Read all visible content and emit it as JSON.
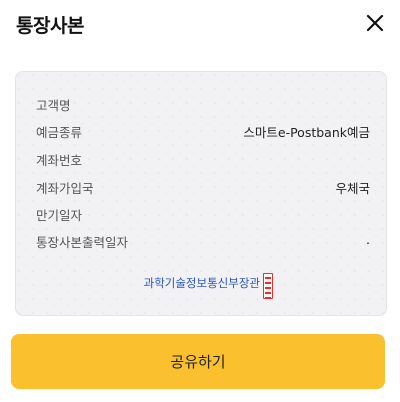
{
  "header": {
    "title": "통장사본",
    "close_icon": "close-icon"
  },
  "card": {
    "rows": [
      {
        "label": "고객명",
        "value": ""
      },
      {
        "label": "예금종류",
        "value": "스마트e-Postbank예금"
      },
      {
        "label": "계좌번호",
        "value": ""
      },
      {
        "label": "계좌가입국",
        "value": "우체국"
      },
      {
        "label": "만기일자",
        "value": ""
      },
      {
        "label": "통장사본출력일자",
        "value": "."
      }
    ],
    "issuer": "과학기술정보통신부장관",
    "seal_icon": "official-seal-icon"
  },
  "actions": {
    "share_label": "공유하기"
  },
  "colors": {
    "accent": "#fbc02d",
    "issuer_text": "#2b56c4",
    "card_bg": "#f2f2f4"
  }
}
